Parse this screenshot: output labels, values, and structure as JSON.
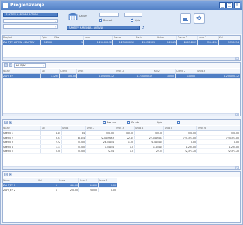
{
  "window": {
    "title": "Pregledavanje",
    "controls": [
      "_",
      "□",
      "×"
    ]
  },
  "toolbar": {
    "filter1_value": "ZAHTJEV NAREDBA AKTIVNI",
    "date_label": "Datum",
    "checkbox1_label": "Bez sub",
    "checkbox2_label": "Upis",
    "filter2_value": "ZAHTJEV NAREDBA - AKTIVNI"
  },
  "grid1": {
    "headers": [
      "Pregled",
      "Opis",
      "Sifra",
      "Iznos",
      "Datum",
      "Naziv",
      "Status",
      "Datum 2",
      "Iznos 2",
      "Kol"
    ],
    "rows": [
      [
        "ZAHTJEV AKTIVNI - ZAHTJEV",
        "123.00",
        "1",
        "1.234.000.12",
        "1.234.000.12",
        "24.03.2009",
        "1.234.5",
        "24.03.2009",
        "999.1234",
        "999.1234"
      ]
    ]
  },
  "grid2": {
    "dropdown": "ZAHTJEV",
    "headers": [
      "Naziv",
      "Kol",
      "Cijena",
      "Iznos",
      "Iznos 2",
      "Kol 2",
      "Cijena 2",
      "Iznos 3"
    ],
    "rows": [
      [
        "ZAHTJEV",
        "1,1234",
        "100.00",
        "1.000.000.12",
        "1.234.000.12",
        "100.00",
        "100.00",
        "1.234.000.12"
      ]
    ]
  },
  "grid3": {
    "options": [
      "Bez sub",
      "Sa sub",
      "Upis"
    ],
    "headers": [
      "Naziv",
      "Kol",
      "Iznos",
      "Iznos 2",
      "Iznos 3",
      "Iznos 4",
      "Iznos 5",
      "Iznos 6"
    ],
    "rows": [
      [
        "Stavka 1",
        "4.44",
        "84",
        "500.00",
        "500.00",
        "500.00",
        "500.00",
        "500.00"
      ],
      [
        "Stavka 2",
        "3.33",
        "8,444",
        "22.4449463",
        "22.44",
        "22.4449463",
        "724.323.00",
        "724.323.00"
      ],
      [
        "Stavka 3",
        "2.22",
        "5.000",
        "28.44444",
        "1.00",
        "21.444444",
        "0.00",
        "0.00"
      ],
      [
        "Stavka 4",
        "1.11",
        "5.000",
        "1.44444",
        "1.0",
        "1.44444",
        "1,234.00",
        "1,234.00"
      ],
      [
        "Stavka 5",
        "0.00",
        "5.000",
        "22.54",
        "1.0",
        "22.54",
        "22,373.70",
        "22,373.70"
      ]
    ]
  },
  "grid4": {
    "headers": [
      "Naziv",
      "Kol",
      "Iznos",
      "Iznos 2",
      "Iznos 3"
    ],
    "rows": [
      [
        "ZAHTJEV 1",
        "1",
        "444.00",
        "444.00",
        "0.00"
      ],
      [
        "ZAHTJEV 2",
        "1",
        "200.00",
        "200.00",
        "0.00"
      ]
    ]
  }
}
